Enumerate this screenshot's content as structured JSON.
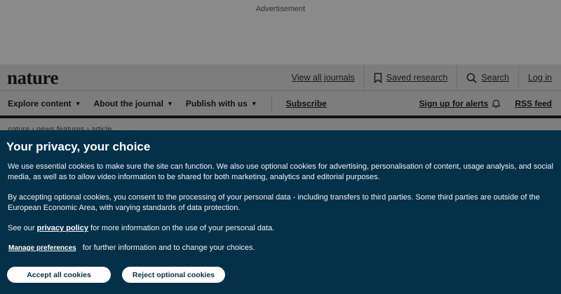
{
  "ad": {
    "label": "Advertisement"
  },
  "header": {
    "logo": "nature",
    "links": {
      "journals": "View all journals",
      "saved": "Saved research",
      "search": "Search",
      "login": "Log in"
    }
  },
  "nav": {
    "explore": "Explore content",
    "about": "About the journal",
    "publish": "Publish with us",
    "subscribe": "Subscribe",
    "alerts": "Sign up for alerts",
    "rss": "RSS feed"
  },
  "breadcrumb": "nature  ›  news features  ›  article",
  "consent": {
    "title": "Your privacy, your choice",
    "p1": "We use essential cookies to make sure the site can function. We also use optional cookies for advertising, personalisation of content, usage analysis, and social media, as well as to allow video information to be shared for both marketing, analytics and editorial purposes.",
    "p2": "By accepting optional cookies, you consent to the processing of your personal data - including transfers to third parties. Some third parties are outside of the European Economic Area, with varying standards of data protection.",
    "p3_prefix": "See our ",
    "p3_link": "privacy policy",
    "p3_suffix": " for more information on the use of your personal data.",
    "manage": "Manage preferences",
    "manage_suffix": "for further information and to change your choices.",
    "accept": "Accept all cookies",
    "reject": "Reject optional cookies"
  },
  "colors": {
    "panel": "#04304a",
    "button_bg": "#ffffff",
    "overlay_gray": "#7f7f7f"
  }
}
